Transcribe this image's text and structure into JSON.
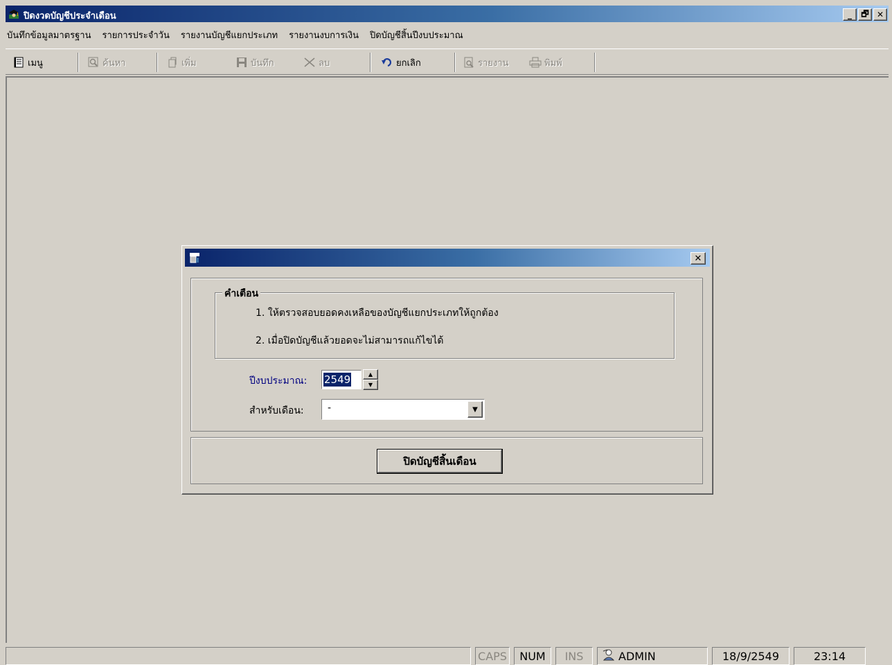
{
  "window": {
    "title": "ปิดงวดบัญชีประจำเดือน",
    "app_icon": "app-graduate-icon"
  },
  "caption_buttons": {
    "minimize": "_",
    "restore": "🗗",
    "close": "✕"
  },
  "menu": [
    "บันทึกข้อมูลมาตรฐาน",
    "รายการประจำวัน",
    "รายงานบัญชีแยกประเภท",
    "รายงานงบการเงิน",
    "ปิดบัญชีสิ้นปีงบประมาณ"
  ],
  "toolbar": {
    "menu": "เมนู",
    "search": "ค้นหา",
    "add": "เพิ่ม",
    "save": "บันทึก",
    "delete": "ลบ",
    "cancel": "ยกเลิก",
    "report": "รายงาน",
    "print": "พิมพ์"
  },
  "dialog": {
    "group_title": "คำเตือน",
    "warning_1": "1. ให้ตรวจสอบยอดคงเหลือของบัญชีแยกประเภทให้ถูกต้อง",
    "warning_2": "2. เมื่อปิดบัญชีแล้วยอดจะไม่สามารถแก้ไขได้",
    "year_label": "ปีงบประมาณ:",
    "year_value": "2549",
    "month_label": "สำหรับเดือน:",
    "month_value": "-",
    "close_button": "ปิดบัญชีสิ้นเดือน",
    "close_x": "✕"
  },
  "status": {
    "caps": "CAPS",
    "num": "NUM",
    "ins": "INS",
    "user": "ADMIN",
    "date": "18/9/2549",
    "time": "23:14"
  },
  "colors": {
    "title_start": "#0a246a",
    "title_end": "#a6caf0",
    "face": "#d4d0c8",
    "year_label": "#000080"
  }
}
